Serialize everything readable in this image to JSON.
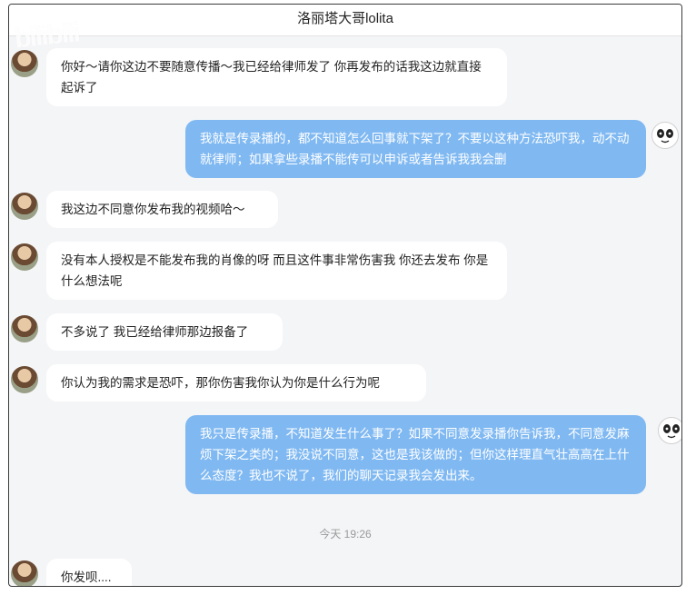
{
  "window": {
    "title": "洛丽塔大哥lolita",
    "watermark_text": "bilibili"
  },
  "messages": [
    {
      "from": "contact",
      "text": "你好～请你这边不要随意传播～我已经给律师发了 你再发布的话我这边就直接起诉了"
    },
    {
      "from": "me",
      "text": "我就是传录播的，都不知道怎么回事就下架了？不要以这种方法恐吓我，动不动就律师；如果拿些录播不能传可以申诉或者告诉我我会删"
    },
    {
      "from": "contact",
      "text": "我这边不同意你发布我的视频哈～"
    },
    {
      "from": "contact",
      "text": "没有本人授权是不能发布我的肖像的呀 而且这件事非常伤害我 你还去发布 你是什么想法呢"
    },
    {
      "from": "contact",
      "text": "不多说了 我已经给律师那边报备了"
    },
    {
      "from": "contact",
      "text": "你认为我的需求是恐吓，那你伤害我你认为你是什么行为呢"
    },
    {
      "from": "me",
      "text": "我只是传录播，不知道发生什么事了？如果不同意发录播你告诉我，不同意发麻烦下架之类的；我没说不同意，这也是我该做的；但你这样理直气壮高高在上什么态度？我也不说了，我们的聊天记录我会发出来。"
    },
    {
      "from": "contact",
      "text": "你发呗...."
    }
  ],
  "time_divider": "今天 19:26"
}
